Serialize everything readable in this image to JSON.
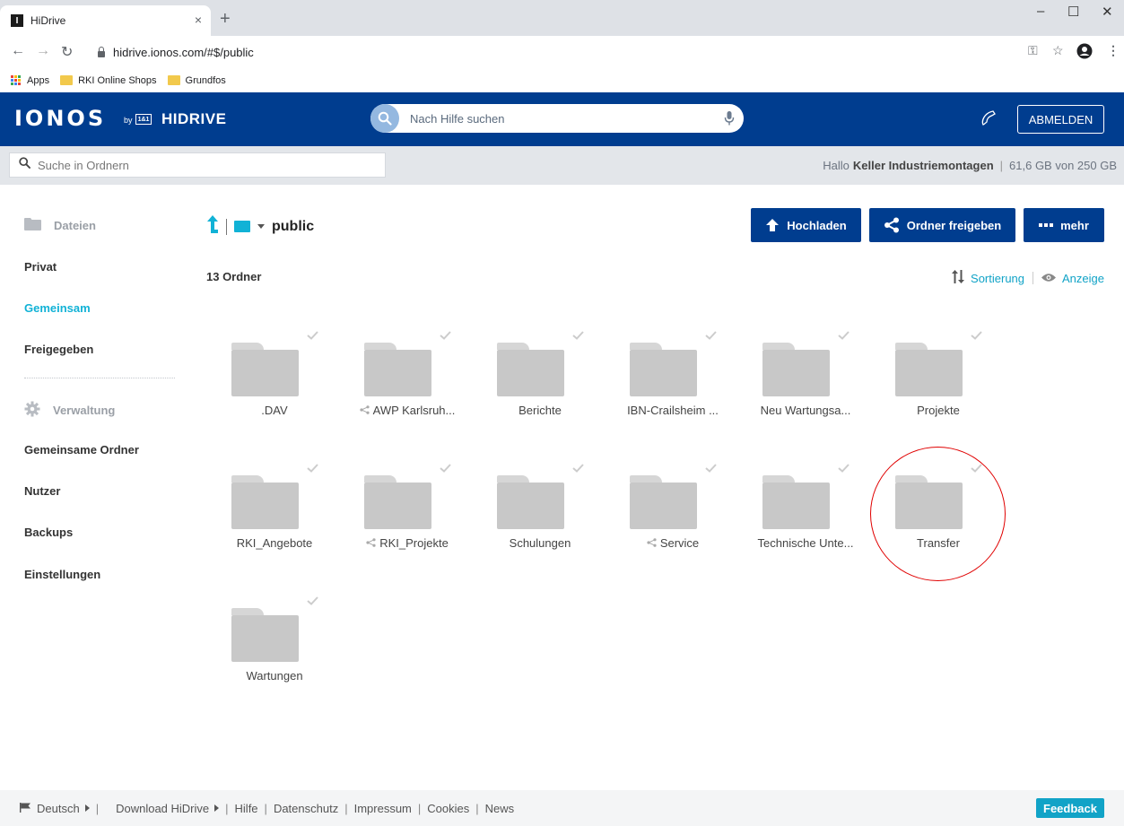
{
  "browser": {
    "tab_title": "HiDrive",
    "tab_close": "×",
    "new_tab": "+",
    "url": "hidrive.ionos.com/#$/public",
    "window_min": "–",
    "window_max": "☐",
    "window_close": "✕",
    "bookmarks": [
      {
        "label": "Apps",
        "icon": "apps-grid-icon"
      },
      {
        "label": "RKI Online Shops",
        "icon": "folder-icon"
      },
      {
        "label": "Grundfos",
        "icon": "folder-icon"
      }
    ]
  },
  "header": {
    "logo": "IONOS",
    "logo_by": "by",
    "logo_brand": "1&1",
    "product": "HIDRIVE",
    "help_search_placeholder": "Nach Hilfe suchen",
    "logout_label": "ABMELDEN"
  },
  "subbar": {
    "folder_search_placeholder": "Suche in Ordnern",
    "greeting_prefix": "Hallo",
    "user_name": "Keller Industriemontagen",
    "storage": "61,6 GB von 250 GB"
  },
  "sidebar": {
    "section_files": "Dateien",
    "files_items": [
      {
        "label": "Privat",
        "active": false
      },
      {
        "label": "Gemeinsam",
        "active": true
      },
      {
        "label": "Freigegeben",
        "active": false
      }
    ],
    "section_admin": "Verwaltung",
    "admin_items": [
      {
        "label": "Gemeinsame Ordner"
      },
      {
        "label": "Nutzer"
      },
      {
        "label": "Backups"
      },
      {
        "label": "Einstellungen"
      }
    ]
  },
  "main": {
    "current_folder": "public",
    "upload_label": "Hochladen",
    "share_label": "Ordner freigeben",
    "more_label": "mehr",
    "folder_count": "13 Ordner",
    "sort_label": "Sortierung",
    "view_label": "Anzeige",
    "folders": [
      {
        "name": ".DAV",
        "shared": false
      },
      {
        "name": "AWP Karlsruh...",
        "shared": true
      },
      {
        "name": "Berichte",
        "shared": false
      },
      {
        "name": "IBN-Crailsheim ...",
        "shared": false
      },
      {
        "name": "Neu Wartungsa...",
        "shared": false
      },
      {
        "name": "Projekte",
        "shared": false
      },
      {
        "name": "RKI_Angebote",
        "shared": false
      },
      {
        "name": "RKI_Projekte",
        "shared": true
      },
      {
        "name": "Schulungen",
        "shared": false
      },
      {
        "name": "Service",
        "shared": true
      },
      {
        "name": "Technische Unte...",
        "shared": false
      },
      {
        "name": "Transfer",
        "shared": false,
        "highlighted": true
      },
      {
        "name": "Wartungen",
        "shared": false
      }
    ]
  },
  "footer": {
    "language": "Deutsch",
    "download": "Download HiDrive",
    "help": "Hilfe",
    "privacy": "Datenschutz",
    "imprint": "Impressum",
    "cookies": "Cookies",
    "news": "News",
    "feedback_label": "Feedback"
  },
  "colors": {
    "brand_blue": "#003d8f",
    "accent_cyan": "#11b2d6",
    "folder_grey": "#c8c8c8",
    "highlight_red": "#e00000"
  }
}
